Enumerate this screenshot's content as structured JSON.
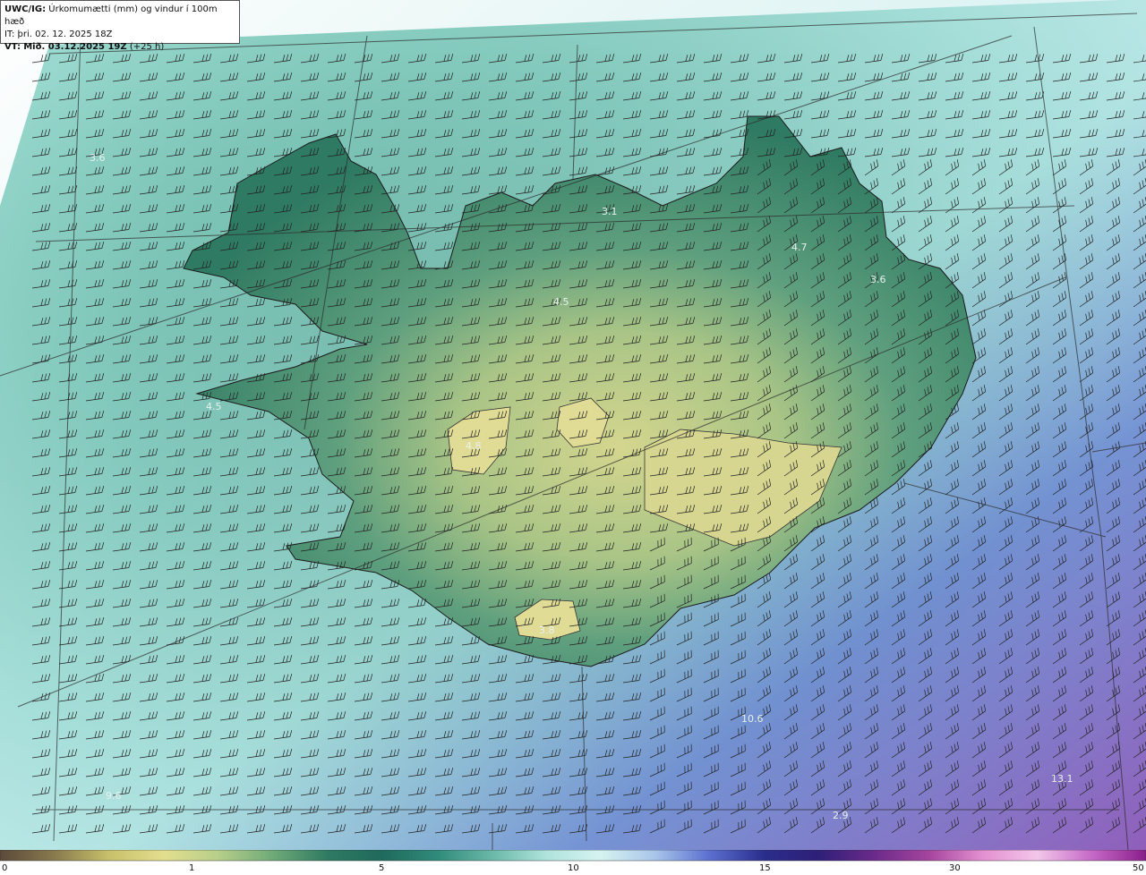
{
  "info": {
    "model_label": "UWC/IG:",
    "description": "Úrkomumætti (mm) og vindur í 100m hæð",
    "it_prefix": "IT:",
    "it_time": "þri. 02. 12. 2025 18Z",
    "vt_prefix": "VT:",
    "vt_time": "Mið. 03.12.2025 19Z",
    "vt_lead": "(+25 h)"
  },
  "value_labels": [
    "4.5",
    "4.7",
    "3.6",
    "4.5",
    "10.6",
    "13.1",
    "9.6",
    "3.1",
    "4.8",
    "3.8",
    "3.6",
    "2.9"
  ],
  "colorbar": {
    "ticks": [
      "0",
      "1",
      "5",
      "10",
      "15",
      "30",
      "50"
    ],
    "colors": [
      "#5b4a3a",
      "#8a7a4e",
      "#c8c06a",
      "#e3de8e",
      "#b7cf8a",
      "#6faa78",
      "#2e7a62",
      "#1f6a5c",
      "#2f8a7a",
      "#69b8a8",
      "#aee3dc",
      "#d6f3f1",
      "#a9c6ea",
      "#5b6fd0",
      "#2a2d8c",
      "#2e1f78",
      "#6a2a8a",
      "#a4449e",
      "#e38fd0",
      "#f3c6ea",
      "#c66ac8",
      "#8a1f8a"
    ]
  },
  "colors": {
    "sea": "#8fd0c4",
    "land_low": "#3d8a72",
    "land_mid": "#6aa882",
    "highland": "#cfd48c",
    "heavy_precip": "#5a64c8",
    "barb": "#222222",
    "coast": "#1a1a1a"
  }
}
